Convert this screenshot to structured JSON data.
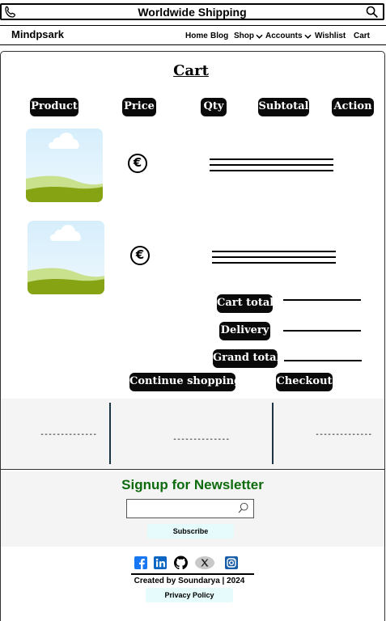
{
  "topbar": {
    "title": "Worldwide Shipping",
    "left_icon": "phone-icon",
    "right_icon": "search-icon"
  },
  "nav": {
    "brand": "Mindpsark",
    "links": [
      "Home",
      "Blog",
      "Shop",
      "Accounts",
      "Wishlist",
      "Cart"
    ]
  },
  "cart": {
    "title": "Cart",
    "columns": [
      "Product",
      "Price",
      "Qty",
      "Subtotal",
      "Action"
    ],
    "items": [
      {
        "image": "landscape-placeholder",
        "price_icon": "euro-icon"
      },
      {
        "image": "landscape-placeholder",
        "price_icon": "euro-icon"
      }
    ],
    "totals": {
      "cart_total": "Cart total",
      "delivery": "Delivery",
      "grand_total": "Grand total"
    },
    "continue_label": "Continue shopping",
    "checkout_label": "Checkout"
  },
  "footer": {
    "columns": [
      "--------------",
      "--------------",
      "--------------"
    ],
    "newsletter_title": "Signup for Newsletter",
    "subscribe_label": "Subscribe",
    "social_icons": [
      "facebook-icon",
      "linkedin-icon",
      "github-icon",
      "x-icon",
      "instagram-icon"
    ],
    "credit": "Created by Soundarya | 2024",
    "privacy_label": "Privacy Policy"
  },
  "colors": {
    "pill_bg": "#0a0a0a",
    "newsletter_title": "#0d6b0d",
    "footer_bg": "#f4f4f4",
    "button_bg": "#e6fbfb"
  }
}
